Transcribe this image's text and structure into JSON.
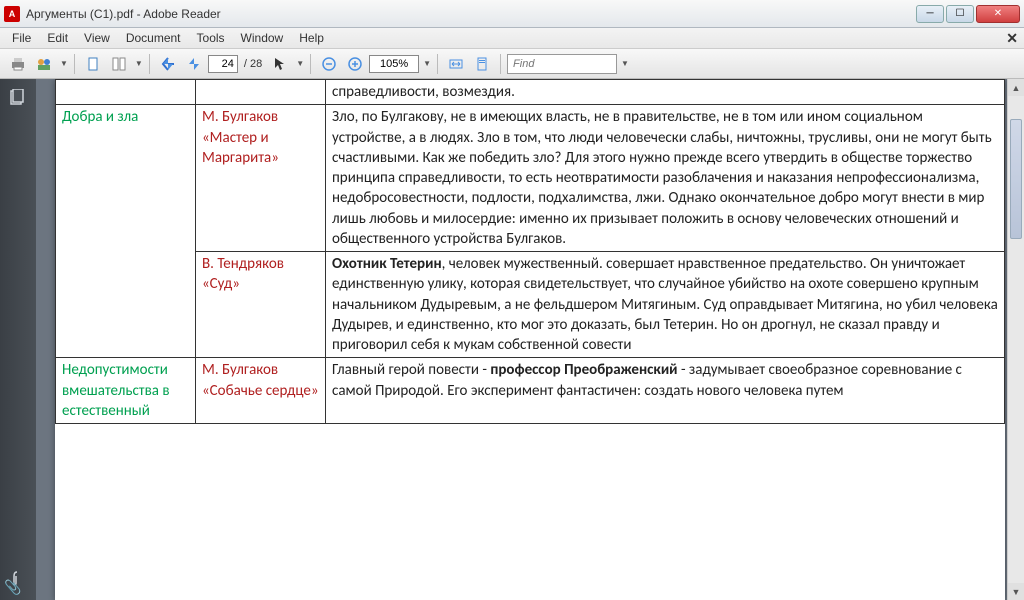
{
  "window": {
    "title": "Аргументы (C1).pdf - Adobe Reader"
  },
  "menu": {
    "file": "File",
    "edit": "Edit",
    "view": "View",
    "document": "Document",
    "tools": "Tools",
    "window": "Window",
    "help": "Help"
  },
  "toolbar": {
    "page_current": "24",
    "page_total": "/ 28",
    "zoom": "105%",
    "find_placeholder": "Find"
  },
  "document": {
    "partial_row_text": "справедливости, возмездия.",
    "rows": [
      {
        "topic": "Добра и зла",
        "source": "М. Булгаков «Мастер и Маргарита»",
        "text": "Зло, по Булгакову, не в имеющих власть, не в правительстве, не в том или ином социальном устройстве, а в людях. Зло в том, что люди человечески слабы, ничтожны, трусливы, они не могут быть счастливыми. Как же победить зло? Для этого нужно прежде всего утвердить в обществе торжество принципа справедливости, то есть неотвратимости разоблачения и наказания непрофессионализма, недобросовестности, подлости, подхалимства, лжи. Однако окончательное добро могут внести в мир лишь любовь и милосердие: именно их призывает положить в основу человеческих отношений и общественного устройства Булгаков."
      },
      {
        "topic": "",
        "source": "В. Тендряков «Суд»",
        "text_bold": "Охотник Тетерин",
        "text": ", человек мужественный. совершает нравственное предательство. Он уничтожает единственную улику, которая свидетельствует, что случайное убийство на охоте совершено крупным начальником Дудыревым, а не фельдшером Митягиным. Суд оправдывает Митягина, но убил человека Дудырев, и единственно, кто мог это доказать, был Тетерин. Но он дрогнул, не сказал правду и приговорил себя к мукам собственной совести"
      },
      {
        "topic": "Недопустимости вмешательства в естественный",
        "source": "М. Булгаков «Собачье сердце»",
        "text_pre": "Главный герой повести - ",
        "text_bold": "профессор Преображенский",
        "text": " - задумывает своеобразное соревнование с самой Природой. Его эксперимент фантастичен: создать нового человека путем"
      }
    ]
  }
}
